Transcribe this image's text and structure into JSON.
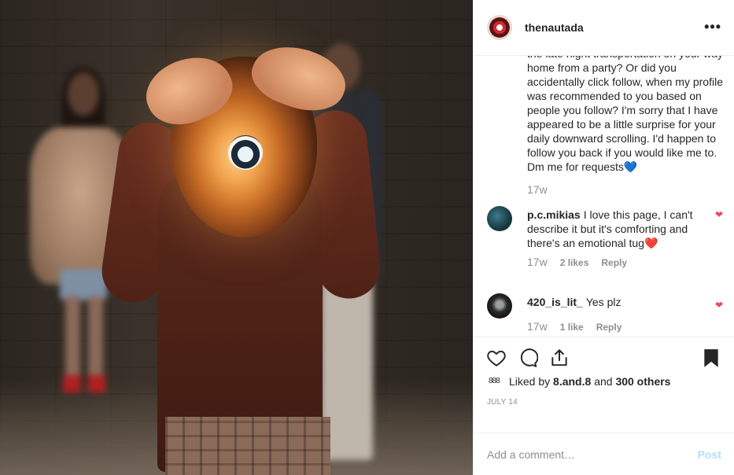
{
  "photo": {
    "alt": ""
  },
  "header": {
    "username": "thenautada",
    "more": "•••"
  },
  "caption": {
    "text": "the late night transportation on your way home from a party? Or did you accidentally click follow, when my profile was recommended to you based on people you follow? I'm sorry that I have appeared to be a little surprise for your daily downward scrolling. I'd happen to follow you back if you would like me to. Dm me for requests💙",
    "time": "17w"
  },
  "comments": [
    {
      "user": "p.c.mikias",
      "text": "I love this page, I can't describe it but it's comforting and there's an emotional tug❤️",
      "time": "17w",
      "likes": "2 likes",
      "reply": "Reply"
    },
    {
      "user": "420_is_lit_",
      "text": "Yes plz",
      "time": "17w",
      "likes": "1 like",
      "reply": "Reply"
    }
  ],
  "actions": {
    "likes_prefix": "Liked by",
    "liked_by_user": "8.and.8",
    "and": "and",
    "others": "300 others",
    "date": "JULY 14"
  },
  "add_comment": {
    "placeholder": "Add a comment…",
    "post_label": "Post"
  },
  "colors": {
    "accent": "#0095f6",
    "post_disabled": "#b2dffc",
    "heart": "#ed4956",
    "text": "#262626",
    "muted": "#8e8e8e"
  },
  "icons": [
    "more-icon",
    "heart-icon",
    "comment-icon",
    "share-icon",
    "bookmark-icon",
    "comment-like-heart-icon"
  ]
}
